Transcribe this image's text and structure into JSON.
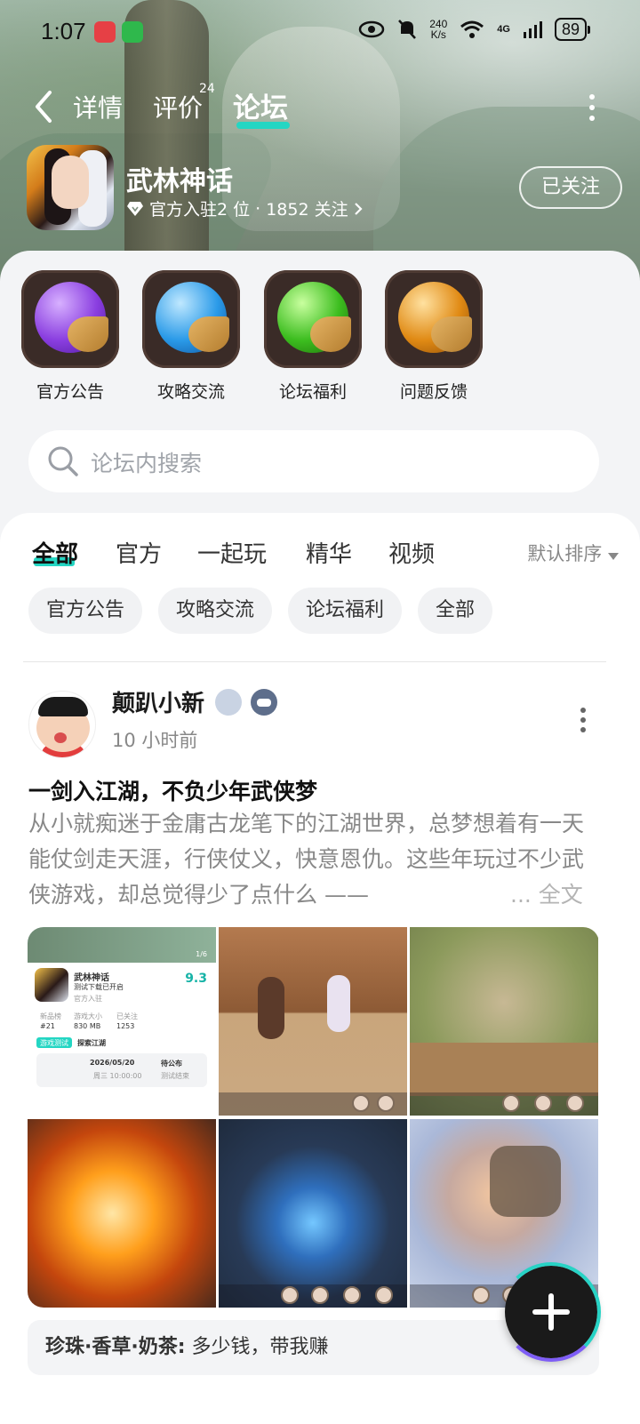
{
  "status_bar": {
    "time": "1:07",
    "net_speed_value": "240",
    "net_speed_unit": "K/s",
    "network_type": "4G",
    "battery": "89"
  },
  "nav": {
    "tabs": [
      {
        "label": "详情"
      },
      {
        "label": "评价",
        "count": "24"
      },
      {
        "label": "论坛"
      }
    ]
  },
  "game": {
    "name": "武林神话",
    "meta_official": "官方入驻2 位",
    "meta_sep": "·",
    "meta_followers": "1852 关注",
    "follow_label": "已关注"
  },
  "categories": [
    {
      "label": "官方公告",
      "color": "#8a3ee0"
    },
    {
      "label": "攻略交流",
      "color": "#2a9ae8"
    },
    {
      "label": "论坛福利",
      "color": "#3cbd1f"
    },
    {
      "label": "问题反馈",
      "color": "#e08a14"
    }
  ],
  "search": {
    "placeholder": "论坛内搜索"
  },
  "feed_tabs": {
    "items": [
      "全部",
      "官方",
      "一起玩",
      "精华",
      "视频"
    ],
    "sort_label": "默认排序"
  },
  "chips": [
    "官方公告",
    "攻略交流",
    "论坛福利",
    "全部"
  ],
  "post": {
    "author": "颠趴小新",
    "time": "10 小时前",
    "title": "一剑入江湖，不负少年武侠梦",
    "body": "从小就痴迷于金庸古龙笔下的江湖世界，总梦想着有一天能仗剑走天涯，行侠仗义，快意恩仇。这些年玩过不少武侠游戏，却总觉得少了点什么 ——",
    "full_text_label": "... 全文",
    "image1": {
      "game_name": "武林神话",
      "subtitle": "测试下载已开启",
      "official": "官方入驻",
      "score": "9.3",
      "stat1_label": "新品榜",
      "stat1_value": "#21",
      "stat2_label": "游戏大小",
      "stat2_value": "830 MB",
      "stat3_label": "已关注",
      "stat3_value": "1253",
      "test_pill": "游戏测试",
      "test_title": "探索江湖",
      "test_date": "2026/05/20",
      "test_time": "周三 10:00:00",
      "test_status": "待公布",
      "test_status_sub": "测试结束",
      "page": "1/6"
    },
    "comment_user": "珍珠·香草·奶茶:",
    "comment_text": "多少钱，带我赚"
  },
  "fab": {
    "icon": "plus-icon"
  }
}
